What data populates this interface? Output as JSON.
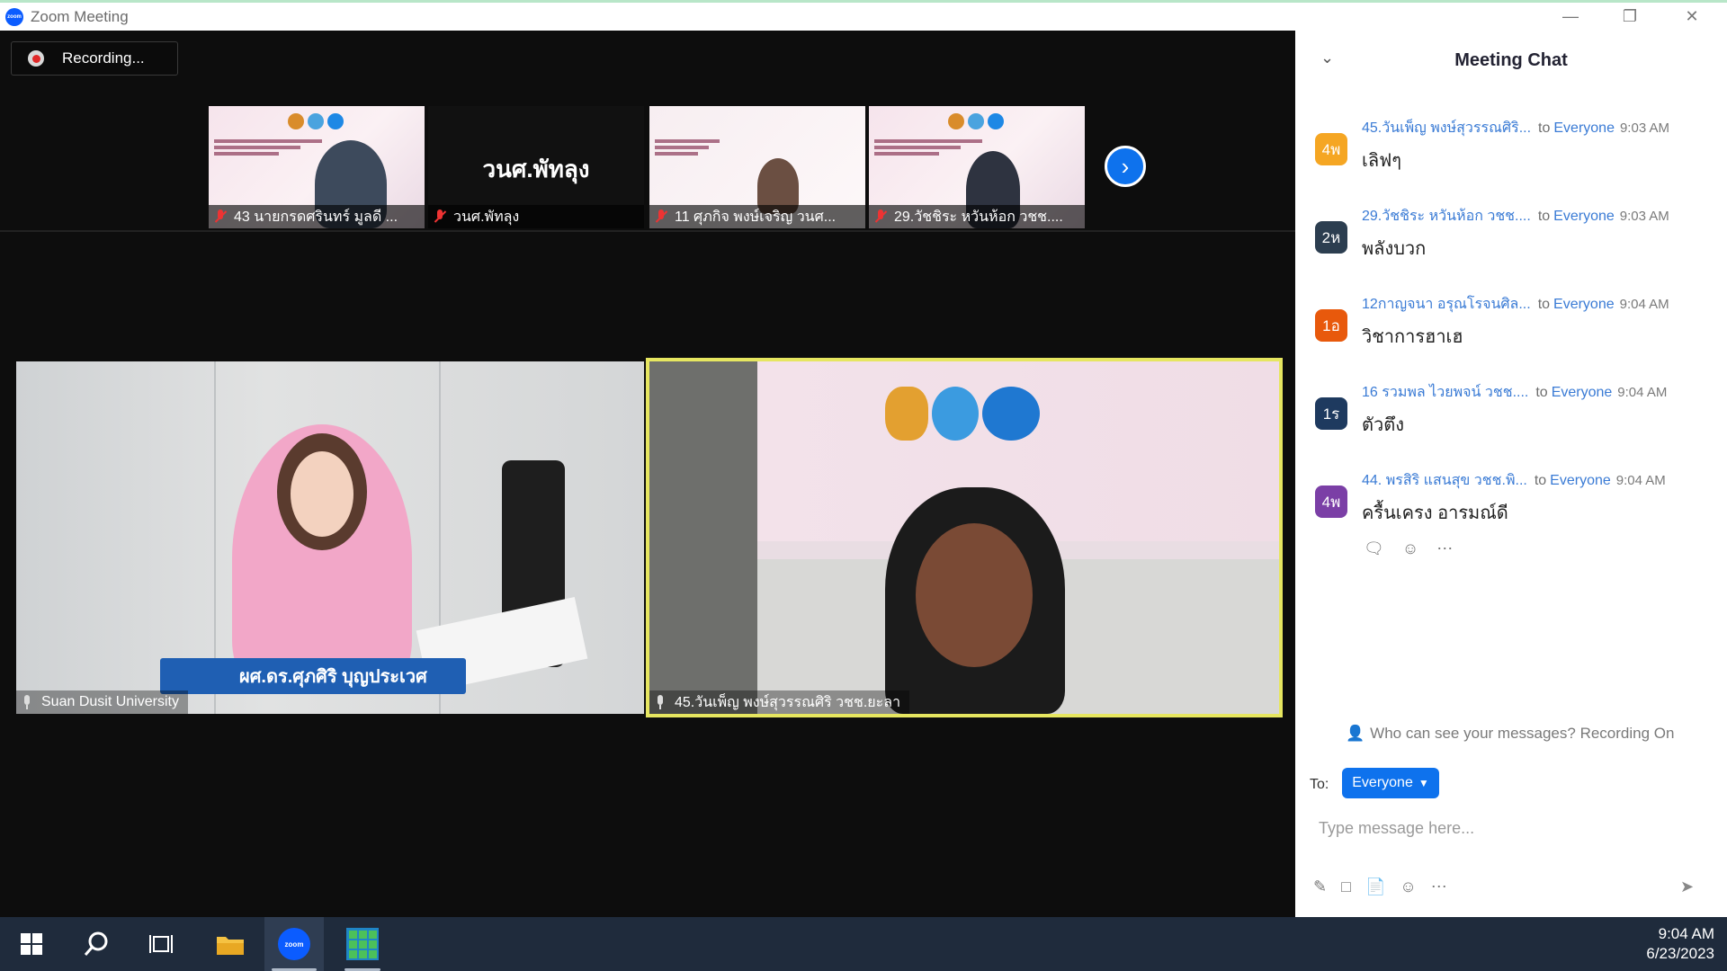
{
  "window": {
    "title": "Zoom Meeting",
    "logo_text": "zoom"
  },
  "recording": {
    "label": "Recording..."
  },
  "thumbnails": [
    {
      "name": "43 นายกรดศรินทร์ มูลดี ..."
    },
    {
      "name": "วนศ.พัทลุง",
      "tile_label": "วนศ.พัทลุง"
    },
    {
      "name": "11 ศุภกิจ พงษ์เจริญ วนศ..."
    },
    {
      "name": "29.วัชชิระ หวันห้อก วชช...."
    }
  ],
  "main_videos": [
    {
      "name": "Suan Dusit University",
      "banner": "ผศ.ดร.ศุภศิริ บุญประเวศ"
    },
    {
      "name": "45.วันเพ็ญ พงษ์สุวรรณศิริ วชช.ยะลา"
    }
  ],
  "chat": {
    "title": "Meeting Chat",
    "messages": [
      {
        "avatar": "4พ",
        "avatar_color": "#f5a623",
        "sender": "45.วันเพ็ญ พงษ์สุวรรณศิริ...",
        "to": "to",
        "recipient": "Everyone",
        "time": "9:03 AM",
        "text": "เลิฟๆ"
      },
      {
        "avatar": "2ห",
        "avatar_color": "#2c3e50",
        "sender": "29.วัชชิระ หวันห้อก วชช....",
        "to": "to",
        "recipient": "Everyone",
        "time": "9:03 AM",
        "text": "พลังบวก"
      },
      {
        "avatar": "1อ",
        "avatar_color": "#e8590c",
        "sender": "12กาญจนา อรุณโรจนศิล...",
        "to": "to",
        "recipient": "Everyone",
        "time": "9:04 AM",
        "text": "วิชาการฮาเฮ"
      },
      {
        "avatar": "1ร",
        "avatar_color": "#1e3a5f",
        "sender": "16 รวมพล ไวยพจน์ วชช....",
        "to": "to",
        "recipient": "Everyone",
        "time": "9:04 AM",
        "text": "ตัวตึง"
      },
      {
        "avatar": "4พ",
        "avatar_color": "#7b3fa6",
        "sender": "44. พรสิริ แสนสุข วชช.พิ...",
        "to": "to",
        "recipient": "Everyone",
        "time": "9:04 AM",
        "text": "ครื้นเครง อารมณ์ดี"
      }
    ],
    "visibility_note": "Who can see your messages? Recording On",
    "to_label": "To:",
    "to_value": "Everyone",
    "input_placeholder": "Type message here..."
  },
  "taskbar": {
    "zoom_label": "zoom",
    "time": "9:04 AM",
    "date": "6/23/2023"
  }
}
